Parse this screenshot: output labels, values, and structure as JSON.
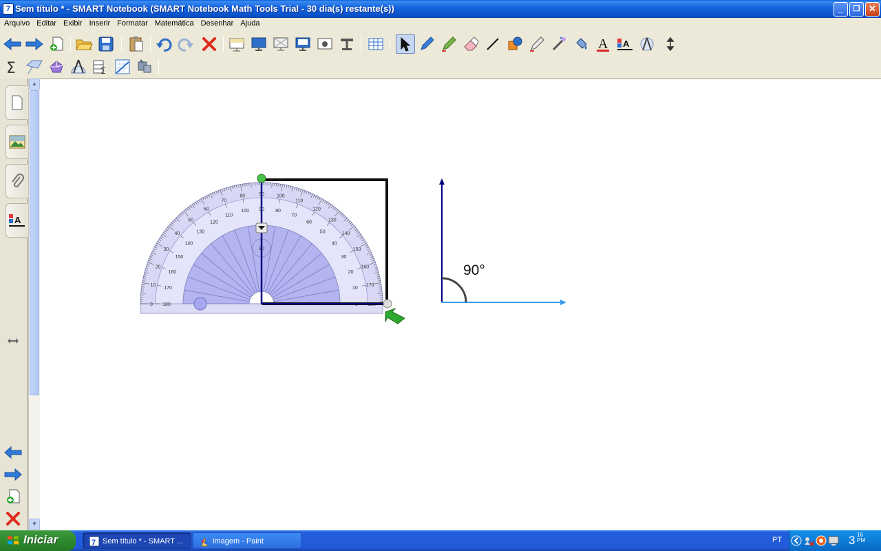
{
  "window": {
    "title": "Sem título * - SMART Notebook (SMART Notebook Math Tools Trial - 30 dia(s) restante(s))",
    "app_icon_glyph": "7",
    "controls": {
      "minimize": "_",
      "restore": "❐",
      "close": "✕"
    }
  },
  "menu": [
    "Arquivo",
    "Editar",
    "Exibir",
    "Inserir",
    "Formatar",
    "Matemática",
    "Desenhar",
    "Ajuda"
  ],
  "toolbar1_icons": [
    "back-arrow-icon",
    "forward-arrow-icon",
    "add-page-icon",
    "open-folder-icon",
    "save-icon",
    "paste-icon",
    "undo-icon",
    "redo-icon",
    "delete-x-icon",
    "screen-shade-icon",
    "full-screen-icon",
    "transparent-background-icon",
    "dual-page-icon",
    "screen-capture-icon",
    "document-camera-icon",
    "table-icon",
    "select-cursor-icon",
    "pen-icon",
    "creative-pen-icon",
    "eraser-icon",
    "line-icon",
    "shapes-icon",
    "magic-pen-icon",
    "fill-icon",
    "text-icon",
    "properties-icon",
    "compass-icon",
    "move-toolbar-icon"
  ],
  "toolbar2_icons": [
    "sigma-icon",
    "geometric-shapes-icon",
    "3d-solids-icon",
    "measurement-tools-icon",
    "table-sum-icon",
    "graph-icon",
    "more-tools-icon"
  ],
  "colors": {
    "titlebar": "#0B52C8",
    "protractor_fill": "#B7B7F2",
    "angle_vertical": "#000080",
    "angle_horizontal": "#3C9AE8",
    "start_green": "#2E8B2E"
  },
  "canvas": {
    "angle_label": "90°",
    "protractor": {
      "outer_scale": [
        "0",
        "10",
        "20",
        "30",
        "40",
        "50",
        "60",
        "70",
        "80",
        "90",
        "100",
        "110",
        "120",
        "130",
        "140",
        "150",
        "160",
        "170",
        "180"
      ],
      "inner_scale": [
        "180",
        "170",
        "160",
        "150",
        "140",
        "130",
        "120",
        "110",
        "100",
        "90",
        "80",
        "70",
        "60",
        "50",
        "40",
        "30",
        "20",
        "10",
        "0"
      ],
      "measured_angle": "90"
    }
  },
  "taskbar": {
    "start_label": "Iniciar",
    "tasks": [
      {
        "label": "Sem título * - SMART ...",
        "icon": "smart-notebook-icon",
        "active": true
      },
      {
        "label": "imagem - Paint",
        "icon": "paint-icon",
        "active": false
      }
    ],
    "language": "PT",
    "clock_hour": "3",
    "clock_minutes": "16",
    "clock_ampm": "PM"
  }
}
